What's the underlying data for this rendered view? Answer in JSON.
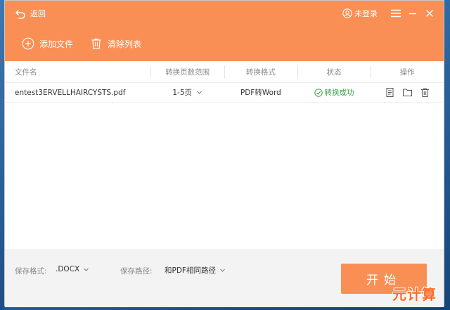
{
  "header": {
    "back_label": "返回",
    "login_label": "未登录"
  },
  "toolbar": {
    "add_file_label": "添加文件",
    "clear_list_label": "清除列表"
  },
  "table": {
    "columns": [
      "文件名",
      "转换页数范围",
      "转换格式",
      "状态",
      "操作"
    ],
    "rows": [
      {
        "file_name": "entest3ERVELLHAIRCYSTS.pdf",
        "page_range": "1-5页",
        "format": "PDF转Word",
        "status": "转换成功"
      }
    ]
  },
  "footer": {
    "save_format_label": "保存格式:",
    "save_format_value": ".DOCX",
    "save_path_label": "保存路径:",
    "save_path_value": "和PDF相同路径",
    "start_label": "开始"
  },
  "watermark": "元计算",
  "colors": {
    "accent": "#f98f55",
    "success": "#3c9a44"
  }
}
